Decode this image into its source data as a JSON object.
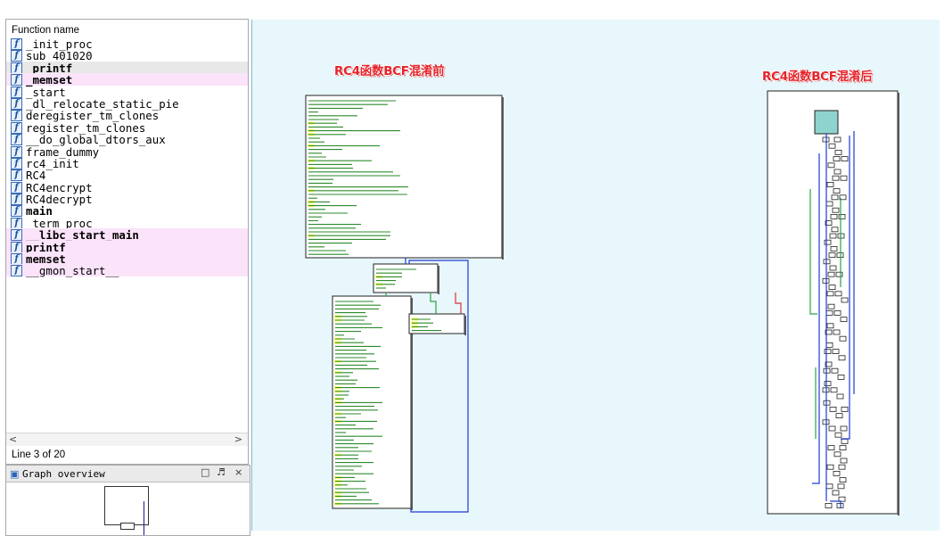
{
  "functions_window": {
    "header": "Function name",
    "functions": [
      {
        "name": "_init_proc",
        "style": "normal"
      },
      {
        "name": "sub_401020",
        "style": "normal"
      },
      {
        "name": "_printf",
        "style": "selected-bold"
      },
      {
        "name": "_memset",
        "style": "lib-bold"
      },
      {
        "name": "_start",
        "style": "normal"
      },
      {
        "name": "_dl_relocate_static_pie",
        "style": "normal"
      },
      {
        "name": "deregister_tm_clones",
        "style": "normal"
      },
      {
        "name": "register_tm_clones",
        "style": "normal"
      },
      {
        "name": "__do_global_dtors_aux",
        "style": "normal"
      },
      {
        "name": "frame_dummy",
        "style": "normal"
      },
      {
        "name": "rc4_init",
        "style": "normal"
      },
      {
        "name": "RC4",
        "style": "normal"
      },
      {
        "name": "RC4encrypt",
        "style": "normal"
      },
      {
        "name": "RC4decrypt",
        "style": "normal"
      },
      {
        "name": "main",
        "style": "bold"
      },
      {
        "name": "_term_proc",
        "style": "normal"
      },
      {
        "name": "__libc_start_main",
        "style": "lib-bold"
      },
      {
        "name": "printf",
        "style": "lib-bold"
      },
      {
        "name": "memset",
        "style": "lib-bold"
      },
      {
        "name": "__gmon_start__",
        "style": "lib"
      }
    ],
    "scroll_left": "<",
    "scroll_right": ">",
    "status": "Line 3 of 20"
  },
  "graph_overview": {
    "title": "Graph overview",
    "buttons": [
      "□",
      "♬",
      "×"
    ]
  },
  "graph_view": {
    "caption_before": "RC4函数BCF混淆前",
    "caption_after": "RC4函数BCF混淆后",
    "colors": {
      "background": "#e8f7fb",
      "node_fill": "#ffffff",
      "node_border": "#222222",
      "asm_text": "#2e8b2e",
      "mnemonic_highlight": "#ffff66",
      "edge_blue": "#1f3bd6",
      "edge_green": "#2ea043",
      "entry_node": "#8fd3cf",
      "caption": "#e4232a"
    }
  }
}
